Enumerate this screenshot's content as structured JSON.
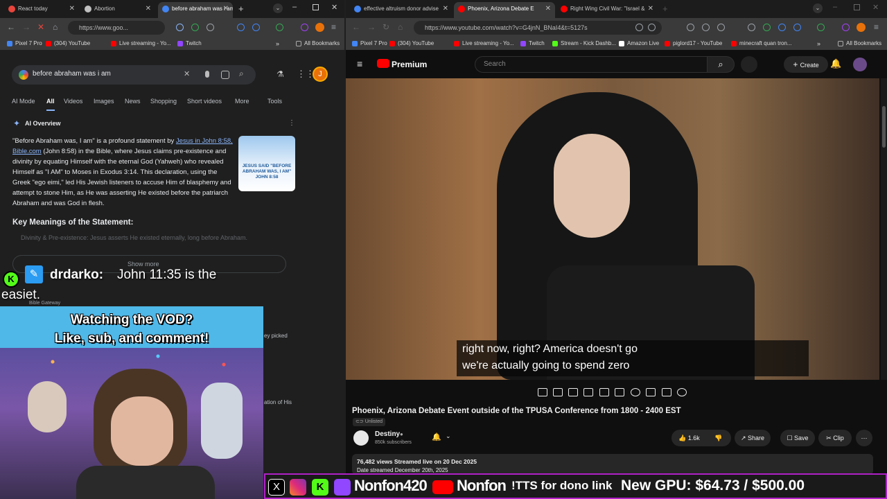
{
  "left_window": {
    "tabs": [
      {
        "title": "React today",
        "active": false
      },
      {
        "title": "Abortion",
        "active": false
      },
      {
        "title": "before abraham was i am",
        "active": true
      }
    ],
    "url": "https://www.goo...",
    "bookmarks": [
      "Pixel 7 Pro",
      "(304) YouTube",
      "Live streaming - Yo...",
      "Twitch"
    ],
    "all_bookmarks": "All Bookmarks"
  },
  "google": {
    "query": "before abraham was i am",
    "avatar_letter": "J",
    "tabs": [
      "AI Mode",
      "All",
      "Videos",
      "Images",
      "News",
      "Shopping",
      "Short videos",
      "More",
      "Tools"
    ],
    "ai_overview_title": "AI Overview",
    "overview_pre": "\"Before Abraham was, I am\" is a profound statement by ",
    "overview_link": "Jesus in John 8:58, Bible.com",
    "overview_post": " (John 8:58) in the Bible, where Jesus claims pre-existence and divinity by equating Himself with the eternal God (Yahweh) who revealed Himself as \"I AM\" to Moses in Exodus 3:14. This declaration, using the Greek \"ego eimi,\" led His Jewish listeners to accuse Him of blasphemy and attempt to stone Him, as He was asserting He existed before the patriarch Abraham and was God in flesh.",
    "card_caption": "JESUS SAID \"BEFORE ABRAHAM WAS, I AM\" JOHN 8:58",
    "key_meanings": "Key Meanings of the Statement:",
    "faded_line": "Divinity & Pre-existence: Jesus asserts He existed eternally, long before Abraham.",
    "show_more": "Show more",
    "source_label": "Bible Gateway",
    "snip_right_1": "ey picked",
    "snip_right_2": "ation of His"
  },
  "overlay": {
    "chat_user": "drdarko:",
    "chat_msg_1": "John 11:35 is the",
    "chat_msg_2": "easiet.",
    "vod_line_1": "Watching the VOD?",
    "vod_line_2": "Like, sub, and comment!"
  },
  "right_window": {
    "tabs": [
      {
        "title": "effective altruism donor advise",
        "active": false
      },
      {
        "title": "Phoenix, Arizona Debate E",
        "active": true
      },
      {
        "title": "Right Wing Civil War: \"Israel &",
        "active": false
      }
    ],
    "url": "https://www.youtube.com/watch?v=G4jnN_BNaI4&t=5127s",
    "bookmarks": [
      "Pixel 7 Pro",
      "(304) YouTube",
      "Live streaming - Yo...",
      "Twitch",
      "Stream - Kick Dashb...",
      "Amazon Live",
      "piglord17 - YouTube",
      "minecraft quan tron..."
    ],
    "all_bookmarks": "All Bookmarks"
  },
  "youtube": {
    "brand": "Premium",
    "search_placeholder": "Search",
    "create": "Create",
    "subtitle_1": "right now, right? America doesn't go",
    "subtitle_2": "we're actually going to spend zero",
    "video_title": "Phoenix, Arizona Debate Event outside of the TPUSA Conference from 1800 - 2400 EST",
    "unlisted": "Unlisted",
    "channel": "Destiny",
    "subscribers": "850k subscribers",
    "likes": "1.6k",
    "share": "Share",
    "save": "Save",
    "clip": "Clip",
    "stats": "76,482 views  Streamed live on 20 Dec 2025",
    "stats_2": "Date streamed December 20th, 2025"
  },
  "stream_bar": {
    "handle_1": "Nonfon420",
    "handle_2": "Nonfon",
    "tts": "!TTS for dono link",
    "goal": "New GPU: $64.73 / $500.00"
  }
}
